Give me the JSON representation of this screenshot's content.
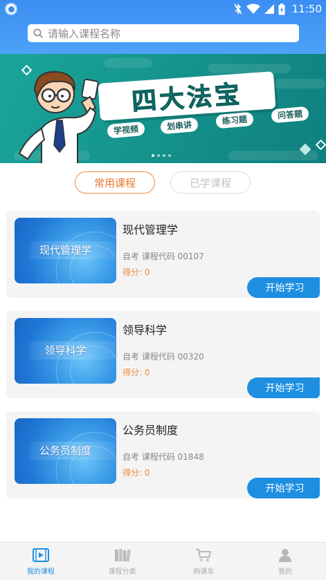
{
  "status_bar": {
    "time": "11:50",
    "icons": [
      "bluetooth-off-icon",
      "wifi-icon",
      "signal-icon",
      "battery-charging-icon"
    ]
  },
  "search": {
    "placeholder": "请输入课程名称",
    "icon": "search-icon"
  },
  "banner": {
    "title": "四大法宝",
    "tags": [
      "学视频",
      "划串讲",
      "练习题",
      "问答题"
    ],
    "page_count": 4,
    "active_page": 1
  },
  "tabs": [
    {
      "label": "常用课程",
      "active": true
    },
    {
      "label": "已学课程",
      "active": false
    }
  ],
  "courses": [
    {
      "thumb_label": "现代管理学",
      "title": "现代管理学",
      "code_line": "自考  课程代码 00107",
      "score": "得分: 0",
      "action": "开始学习"
    },
    {
      "thumb_label": "领导科学",
      "title": "领导科学",
      "code_line": "自考  课程代码 00320",
      "score": "得分: 0",
      "action": "开始学习"
    },
    {
      "thumb_label": "公务员制度",
      "title": "公务员制度",
      "code_line": "自考  课程代码 01848",
      "score": "得分: 0",
      "action": "开始学习"
    }
  ],
  "bottom_nav": [
    {
      "label": "我的课程",
      "icon": "video-course-icon",
      "active": true
    },
    {
      "label": "课程分类",
      "icon": "books-icon",
      "active": false
    },
    {
      "label": "购课车",
      "icon": "shopping-cart-icon",
      "active": false
    },
    {
      "label": "我的",
      "icon": "user-icon",
      "active": false
    }
  ],
  "colors": {
    "header": "#3b8df2",
    "banner": "#15958e",
    "accent_orange": "#f08a3a",
    "primary_blue": "#1e8fe0"
  }
}
